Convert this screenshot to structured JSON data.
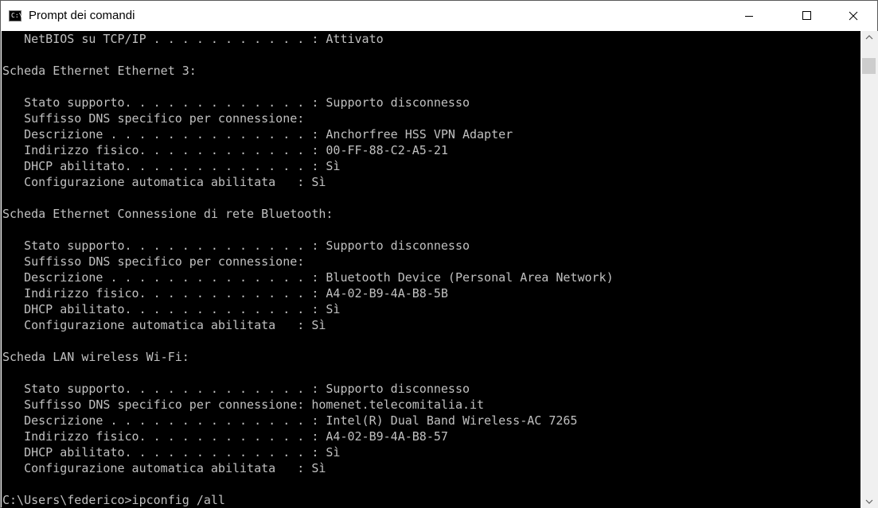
{
  "window": {
    "title": "Prompt dei comandi",
    "icon_label": "C:\\."
  },
  "console": {
    "lines": [
      "   NetBIOS su TCP/IP . . . . . . . . . . . : Attivato",
      "",
      "Scheda Ethernet Ethernet 3:",
      "",
      "   Stato supporto. . . . . . . . . . . . . : Supporto disconnesso",
      "   Suffisso DNS specifico per connessione:",
      "   Descrizione . . . . . . . . . . . . . . : Anchorfree HSS VPN Adapter",
      "   Indirizzo fisico. . . . . . . . . . . . : 00-FF-88-C2-A5-21",
      "   DHCP abilitato. . . . . . . . . . . . . : Sì",
      "   Configurazione automatica abilitata   : Sì",
      "",
      "Scheda Ethernet Connessione di rete Bluetooth:",
      "",
      "   Stato supporto. . . . . . . . . . . . . : Supporto disconnesso",
      "   Suffisso DNS specifico per connessione:",
      "   Descrizione . . . . . . . . . . . . . . : Bluetooth Device (Personal Area Network)",
      "   Indirizzo fisico. . . . . . . . . . . . : A4-02-B9-4A-B8-5B",
      "   DHCP abilitato. . . . . . . . . . . . . : Sì",
      "   Configurazione automatica abilitata   : Sì",
      "",
      "Scheda LAN wireless Wi-Fi:",
      "",
      "   Stato supporto. . . . . . . . . . . . . : Supporto disconnesso",
      "   Suffisso DNS specifico per connessione: homenet.telecomitalia.it",
      "   Descrizione . . . . . . . . . . . . . . : Intel(R) Dual Band Wireless-AC 7265",
      "   Indirizzo fisico. . . . . . . . . . . . : A4-02-B9-4A-B8-57",
      "   DHCP abilitato. . . . . . . . . . . . . : Sì",
      "   Configurazione automatica abilitata   : Sì",
      "",
      "C:\\Users\\federico>ipconfig /all"
    ]
  },
  "icons": {
    "minimize": "minimize-icon",
    "maximize": "maximize-icon",
    "close": "close-icon",
    "scroll_up": "scroll-up-arrow-icon",
    "scroll_down": "scroll-down-arrow-icon"
  },
  "colors": {
    "console_bg": "#000000",
    "console_text": "#c0c0c0",
    "titlebar_bg": "#ffffff",
    "scrollbar_track": "#f0f0f0",
    "scrollbar_thumb": "#cdcdcd"
  }
}
